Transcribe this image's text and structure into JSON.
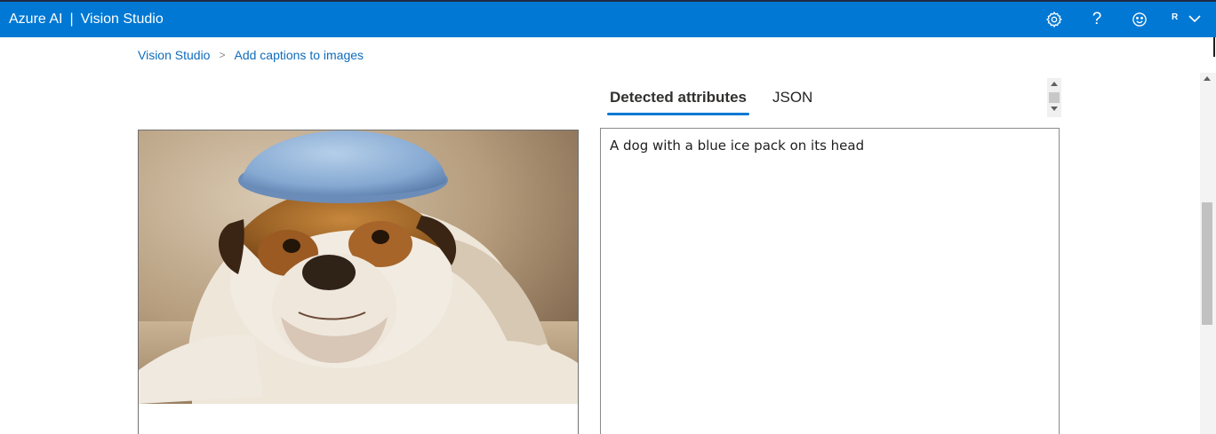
{
  "header": {
    "brand_primary": "Azure AI",
    "brand_separator": "|",
    "brand_secondary": "Vision Studio",
    "avatar_initial": "R",
    "icons": [
      "gear-icon",
      "help-icon",
      "smiley-icon",
      "chevron-down-icon"
    ]
  },
  "breadcrumb": {
    "items": [
      "Vision Studio",
      "Add captions to images"
    ],
    "separator": ">"
  },
  "tabs": [
    {
      "label": "Detected attributes",
      "selected": true
    },
    {
      "label": "JSON",
      "selected": false
    }
  ],
  "result": {
    "caption": "A dog with a blue ice pack on its head"
  },
  "colors": {
    "header_bg": "#0078d4",
    "accent": "#0078d4",
    "link": "#0f6cbd"
  }
}
